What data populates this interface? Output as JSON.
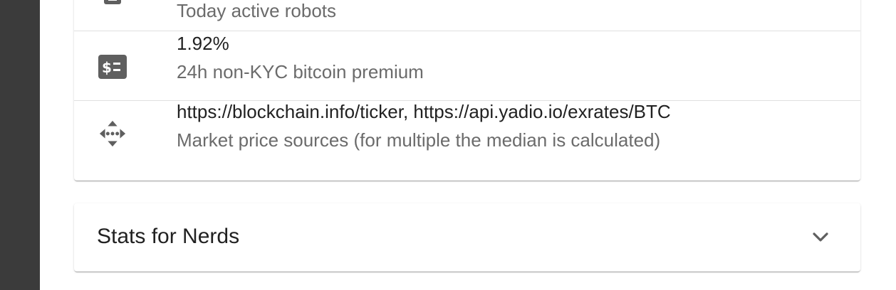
{
  "info_list": {
    "items": [
      {
        "icon": "robot-icon",
        "primary": "",
        "secondary": "Today active robots"
      },
      {
        "icon": "price-change-icon",
        "primary": "1.92%",
        "secondary": "24h non-KYC bitcoin premium"
      },
      {
        "icon": "source-link-icon",
        "primary": "https://blockchain.info/ticker, https://api.yadio.io/exrates/BTC",
        "secondary": "Market price sources (for multiple the median is calculated)"
      }
    ]
  },
  "stats_accordion": {
    "title": "Stats for Nerds",
    "expand_icon": "expand-more-icon"
  },
  "colors": {
    "backdrop": "#3b3b3b",
    "icon": "#5f5f5f",
    "text_primary": "#212121",
    "text_secondary": "#6b6b6b",
    "divider": "#e0e0e0"
  }
}
